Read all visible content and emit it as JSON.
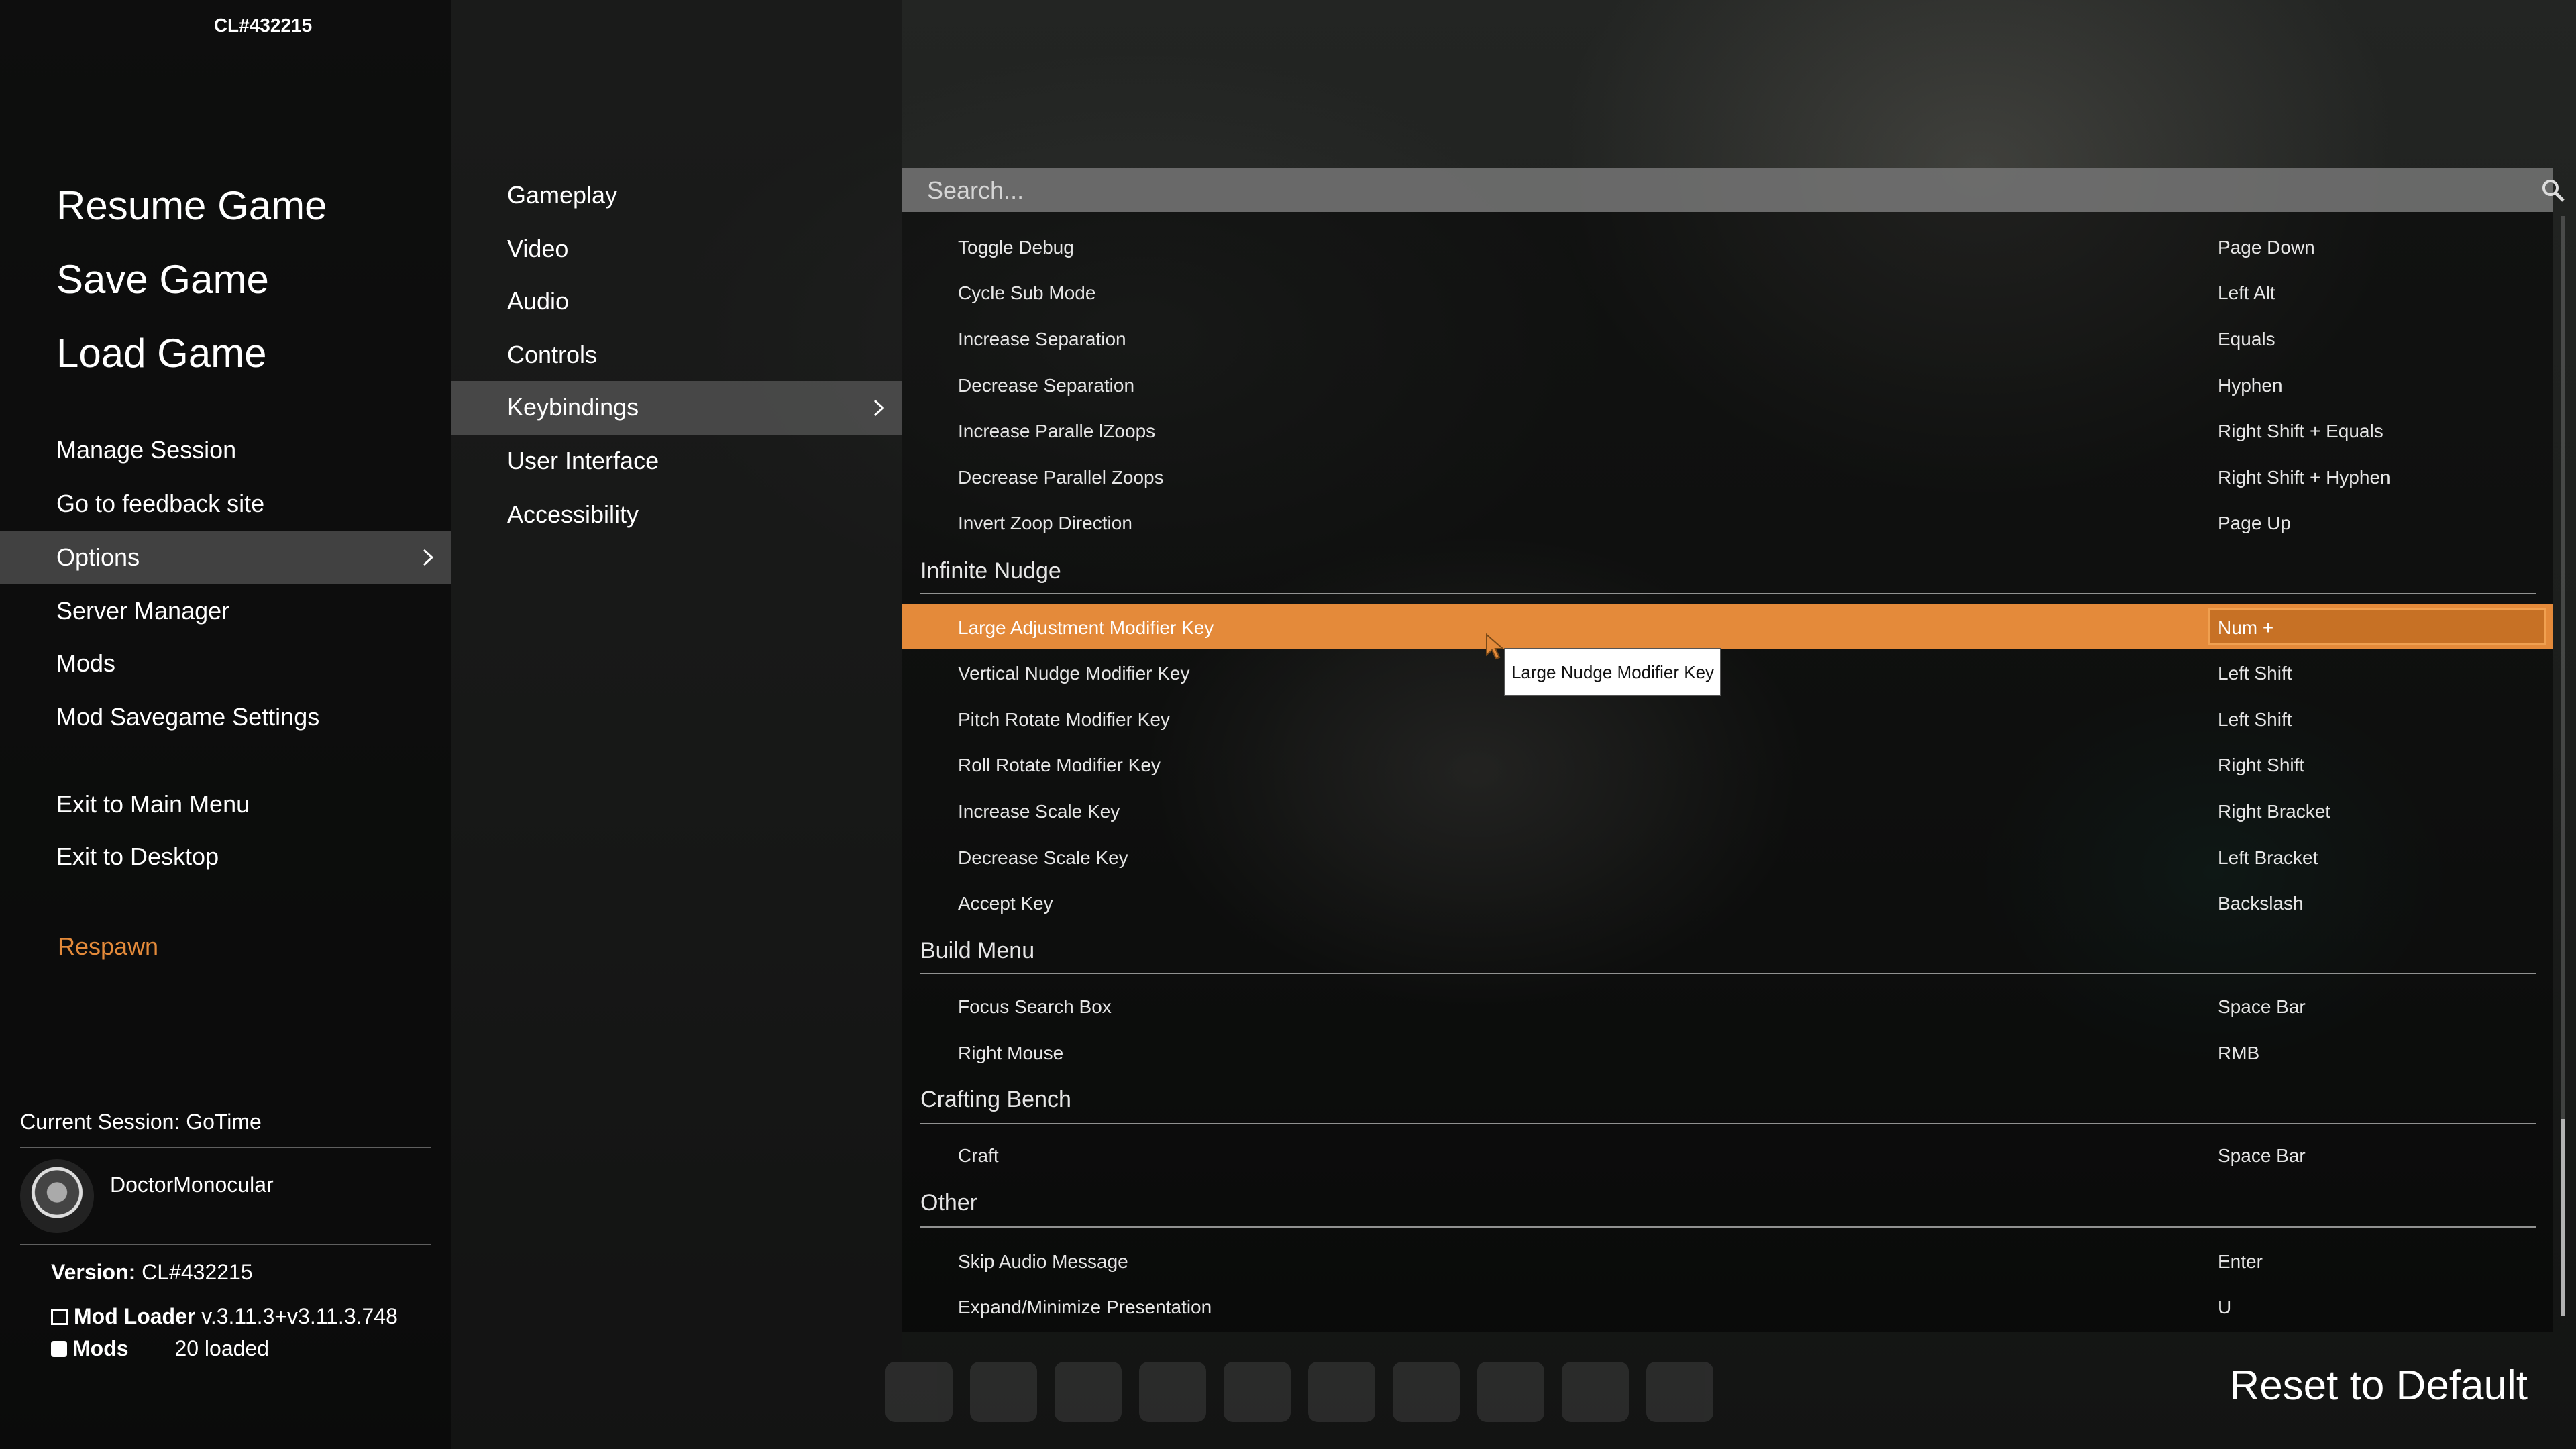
{
  "build_tag": "CL#432215",
  "main_menu": {
    "resume": "Resume Game",
    "save": "Save Game",
    "load": "Load Game",
    "manage_session": "Manage Session",
    "feedback": "Go to feedback site",
    "options": "Options",
    "server_manager": "Server Manager",
    "mods": "Mods",
    "mod_savegame": "Mod Savegame Settings",
    "exit_main": "Exit to Main Menu",
    "exit_desktop": "Exit to Desktop",
    "respawn": "Respawn"
  },
  "session": {
    "current": "Current Session: GoTime",
    "username": "DoctorMonocular",
    "version_label": "Version:",
    "version_value": "CL#432215",
    "mod_loader_label": "Mod Loader",
    "mod_loader_value": "v.3.11.3+v3.11.3.748",
    "mods_label": "Mods",
    "mods_value": "20 loaded"
  },
  "options_menu": {
    "gameplay": "Gameplay",
    "video": "Video",
    "audio": "Audio",
    "controls": "Controls",
    "keybindings": "Keybindings",
    "ui": "User Interface",
    "accessibility": "Accessibility"
  },
  "search": {
    "placeholder": "Search..."
  },
  "rows": [
    {
      "label": "Toggle Debug",
      "value": "Page Down"
    },
    {
      "label": "Cycle Sub Mode",
      "value": "Left Alt"
    },
    {
      "label": "Increase Separation",
      "value": "Equals"
    },
    {
      "label": "Decrease Separation",
      "value": "Hyphen"
    },
    {
      "label": "Increase Paralle lZoops",
      "value": "Right Shift + Equals"
    },
    {
      "label": "Decrease Parallel Zoops",
      "value": "Right Shift + Hyphen"
    },
    {
      "label": "Invert Zoop Direction",
      "value": "Page Up"
    },
    {
      "label": "Large Adjustment Modifier Key",
      "value": "Num +"
    },
    {
      "label": "Vertical Nudge Modifier Key",
      "value": "Left Shift"
    },
    {
      "label": "Pitch Rotate Modifier Key",
      "value": "Left Shift"
    },
    {
      "label": "Roll Rotate Modifier Key",
      "value": "Right Shift"
    },
    {
      "label": "Increase Scale Key",
      "value": "Right Bracket"
    },
    {
      "label": "Decrease Scale Key",
      "value": "Left Bracket"
    },
    {
      "label": "Accept Key",
      "value": "Backslash"
    },
    {
      "label": "Focus Search Box",
      "value": "Space Bar"
    },
    {
      "label": "Right Mouse",
      "value": "RMB"
    },
    {
      "label": "Craft",
      "value": "Space Bar"
    },
    {
      "label": "Skip Audio Message",
      "value": "Enter"
    },
    {
      "label": "Expand/Minimize Presentation",
      "value": "U"
    }
  ],
  "sections": {
    "infinite_nudge": "Infinite Nudge",
    "build_menu": "Build Menu",
    "crafting_bench": "Crafting Bench",
    "other": "Other"
  },
  "tooltip": "Large Nudge Modifier Key",
  "reset_label": "Reset to Default",
  "colors": {
    "accent": "#e48a3a",
    "highlight_value_bg": "#c77125"
  }
}
